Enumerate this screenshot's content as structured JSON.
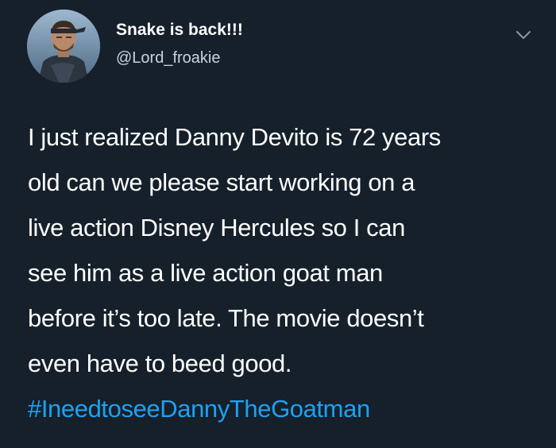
{
  "tweet": {
    "display_name": "Snake is back!!!",
    "handle": "@Lord_froakie",
    "menu_icon": "chevron-down-icon",
    "avatar_icon": "avatar-soldier-icon",
    "lines": [
      "I just realized Danny Devito is 72 years",
      "old can we please start working on a",
      "live action Disney Hercules so I can",
      "see him as a live action goat man",
      "before it’s too late. The movie doesn’t",
      "even have to beed good."
    ],
    "hashtag": "#IneedtoseeDannyTheGoatman"
  },
  "colors": {
    "background": "#15202b",
    "text": "#ffffff",
    "secondary_text": "#c8d3dd",
    "link": "#1da1f2"
  }
}
